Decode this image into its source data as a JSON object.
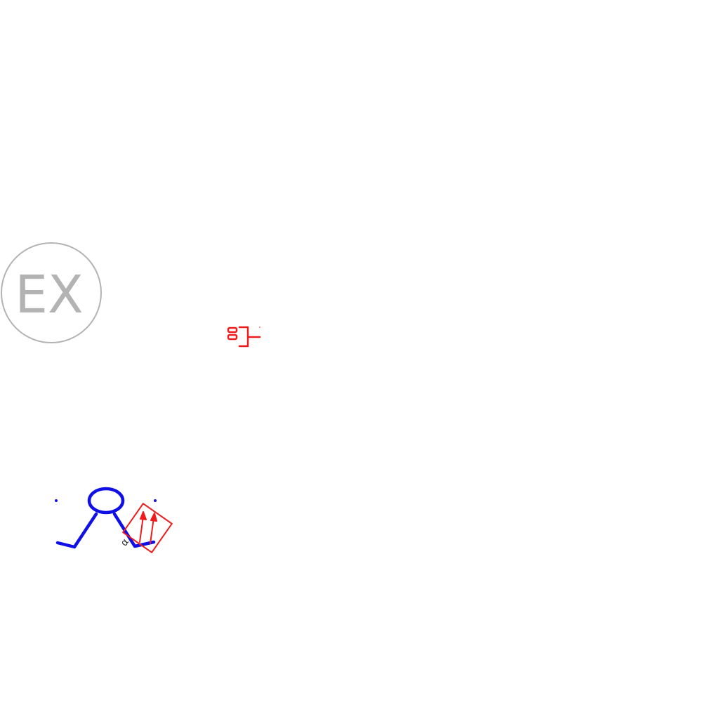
{
  "badge": {
    "text": "EX"
  },
  "labels": {
    "rotated_small": "α"
  },
  "colors": {
    "badge_stroke": "#b3b3b3",
    "badge_text": "#b3b3b3",
    "figure_blue": "#1010e6",
    "symbol_red": "#ee1c1c",
    "label_dark": "#333333",
    "background": "#ffffff"
  },
  "icons": {
    "badge": "ex-circle-badge",
    "red_symbol": "red-bracket-glyph",
    "stick_figure": "stick-figure-icon",
    "red_box": "red-diamond-arrows-icon"
  }
}
